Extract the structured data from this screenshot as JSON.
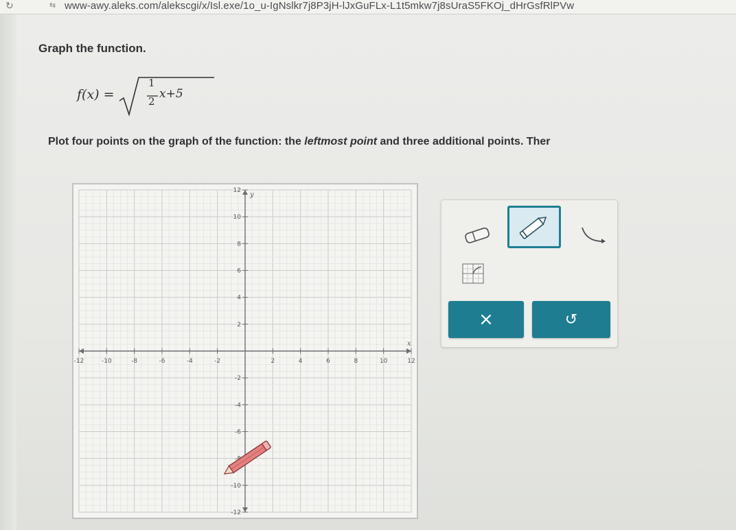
{
  "browser": {
    "url": "www-awy.aleks.com/alekscgi/x/Isl.exe/1o_u-IgNslkr7j8P3jH-lJxGuFLx-L1t5mkw7j8sUraS5FKOj_dHrGsfRlPVw"
  },
  "problem": {
    "instruction": "Graph the function.",
    "function_name": "f(x) =",
    "fraction_numerator": "1",
    "fraction_denominator": "2",
    "radicand_rest": "x+5",
    "plot_instruction_before": "Plot four points on the graph of the function: the ",
    "plot_instruction_emph": "leftmost point",
    "plot_instruction_after": " and three additional points. Ther"
  },
  "graph": {
    "x_axis_label": "x",
    "y_axis_label": "y",
    "x_tick_labels": [
      "-12",
      "-10",
      "-8",
      "-6",
      "-4",
      "-2",
      "2",
      "4",
      "6",
      "8",
      "10",
      "12"
    ],
    "y_tick_labels": [
      "12",
      "10",
      "8",
      "6",
      "4",
      "2",
      "-2",
      "-4",
      "-6",
      "-8",
      "-10",
      "-12"
    ],
    "x_range": [
      -12,
      12
    ],
    "y_range": [
      -12,
      12
    ],
    "grid": true
  },
  "tools": {
    "point_tool": "point-tool-icon",
    "pencil_tool": "pencil-tool-icon",
    "curve_tool": "curve-tool-icon",
    "half_tool": "half-graph-tool-icon",
    "clear_label": "×",
    "undo_label": "↺",
    "accent_color": "#1f7d91"
  }
}
